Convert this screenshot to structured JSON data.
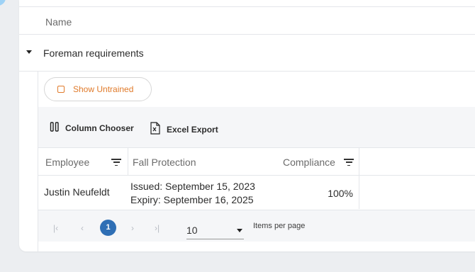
{
  "grid": {
    "name_header": "Name"
  },
  "group": {
    "label": "Foreman requirements"
  },
  "detail": {
    "show_untrained_label": "Show Untrained",
    "toolbar": {
      "column_chooser_label": "Column Chooser",
      "excel_export_label": "Excel Export"
    },
    "columns": {
      "employee": "Employee",
      "fall_protection": "Fall Protection",
      "compliance": "Compliance"
    },
    "rows": [
      {
        "employee": "Justin Neufeldt",
        "issued": "Issued: September 15, 2023",
        "expiry": "Expiry: September 16, 2025",
        "compliance": "100%"
      }
    ],
    "pager": {
      "current_page": "1",
      "page_size": "10",
      "items_per_page_label": "Items per page"
    }
  },
  "colors": {
    "accent_orange": "#e07a2a",
    "pager_blue": "#2f6fb5"
  }
}
